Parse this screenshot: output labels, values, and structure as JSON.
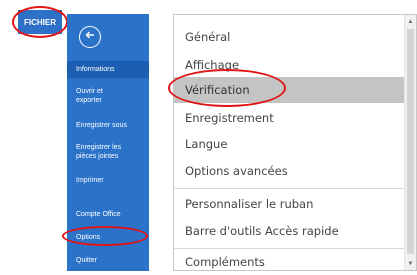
{
  "file_tab": {
    "label": "FICHIER"
  },
  "sidebar": {
    "items": [
      {
        "label": "Informations"
      },
      {
        "label": "Ouvrir et exporter"
      },
      {
        "label": "Enregistrer sous"
      },
      {
        "label": "Enregistrer les pièces jointes"
      },
      {
        "label": "Imprimer"
      },
      {
        "label": "Compte Office"
      },
      {
        "label": "Options"
      },
      {
        "label": "Quitter"
      }
    ]
  },
  "options_panel": {
    "items": [
      {
        "label": "Général"
      },
      {
        "label": "Affichage"
      },
      {
        "label": "Vérification"
      },
      {
        "label": "Enregistrement"
      },
      {
        "label": "Langue"
      },
      {
        "label": "Options avancées"
      },
      {
        "label": "Personnaliser le ruban"
      },
      {
        "label": "Barre d'outils Accès rapide"
      },
      {
        "label": "Compléments"
      }
    ]
  },
  "colors": {
    "accent": "#2b72c9",
    "highlight_ring": "#e01616",
    "selected_bg": "#c4c4c4"
  },
  "icons": {
    "back": "arrow-left-circle",
    "scroll_up": "triangle-up",
    "scroll_down": "triangle-down"
  }
}
